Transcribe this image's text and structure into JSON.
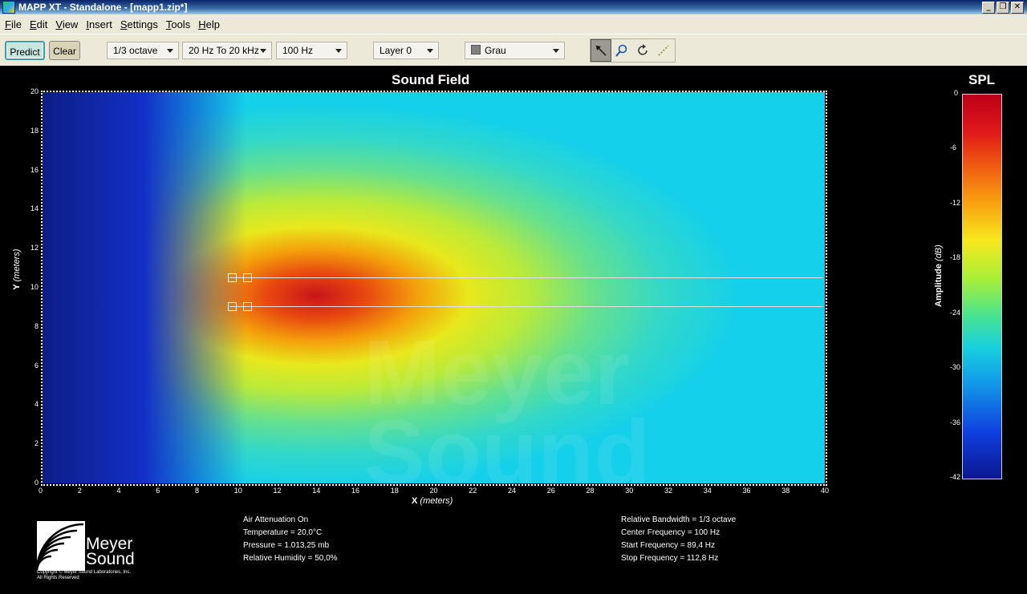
{
  "window": {
    "title": "MAPP XT - Standalone - [mapp1.zip*]",
    "buttons": [
      "_",
      "❐",
      "✕"
    ]
  },
  "menu": [
    "File",
    "Edit",
    "View",
    "Insert",
    "Settings",
    "Tools",
    "Help"
  ],
  "toolbar": {
    "predict_label": "Predict",
    "clear_label": "Clear",
    "bandwidth": "1/3 octave",
    "range": "20 Hz To 20 kHz",
    "frequency": "100 Hz",
    "layer": "Layer 0",
    "color": "Grau",
    "tools": [
      "pointer-icon",
      "zoom-icon",
      "rotate-icon",
      "measure-icon"
    ]
  },
  "sound_field": {
    "title": "Sound Field",
    "x_label": "X",
    "x_unit": "(meters)",
    "y_label": "Y",
    "y_unit": "(meters)",
    "x_ticks": [
      "0",
      "2",
      "4",
      "6",
      "8",
      "10",
      "12",
      "14",
      "16",
      "18",
      "20",
      "22",
      "24",
      "26",
      "28",
      "30",
      "32",
      "34",
      "36",
      "38",
      "40"
    ],
    "y_ticks": [
      "20",
      "18",
      "16",
      "14",
      "12",
      "10",
      "8",
      "6",
      "4",
      "2",
      "0"
    ],
    "watermark": "Meyer Sound"
  },
  "spl_scale": {
    "title": "SPL",
    "axis_label": "Amplitude",
    "axis_unit": "(dB)",
    "ticks": [
      "0",
      "-6",
      "-12",
      "-18",
      "-24",
      "-30",
      "-36",
      "-42"
    ]
  },
  "environment": [
    "Air Attenuation On",
    "Temperature = 20,0°C",
    "Pressure = 1.013,25  mb",
    "Relative Humidity = 50,0%"
  ],
  "frequency_info": [
    "Relative Bandwidth = 1/3 octave",
    "Center Frequency = 100 Hz",
    "Start Frequency = 89,4 Hz",
    "Stop Frequency = 112,8 Hz"
  ],
  "logo": {
    "line1": "Meyer",
    "line2": "Sound",
    "copyright": "Copyright © Meyer Sound Laboratories, Inc.",
    "rights": "All Rights Reserved"
  }
}
